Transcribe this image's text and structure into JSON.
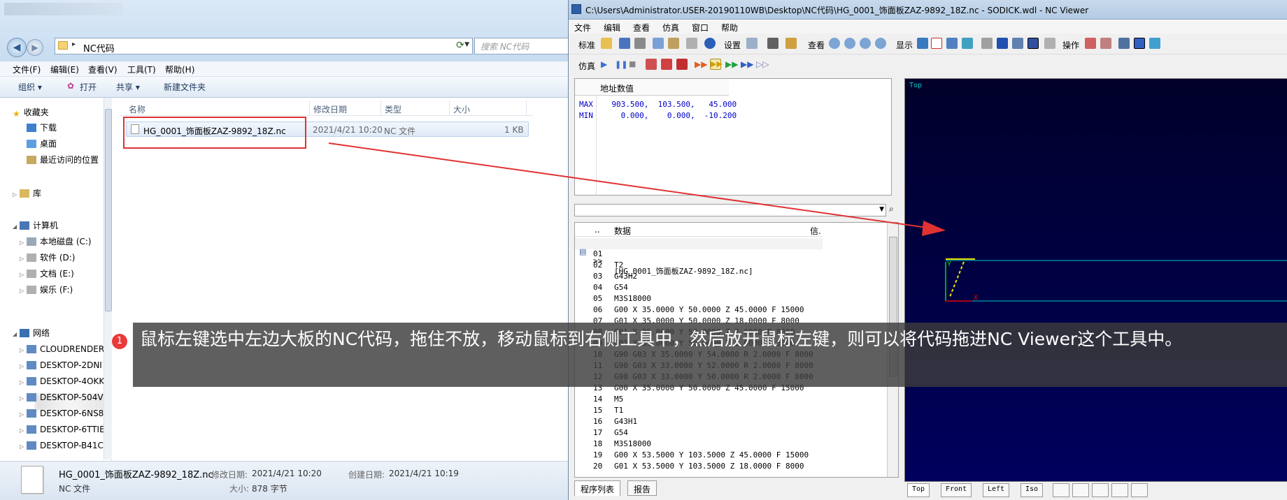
{
  "explorer": {
    "address": "NC代码",
    "search_placeholder": "搜索 NC代码",
    "menu": [
      "文件(F)",
      "编辑(E)",
      "查看(V)",
      "工具(T)",
      "帮助(H)"
    ],
    "commands": {
      "organize": "组织 ▾",
      "open": "打开",
      "share": "共享 ▾",
      "new_folder": "新建文件夹"
    },
    "nav": {
      "favorites": "收藏夹",
      "downloads": "下载",
      "desktop": "桌面",
      "recent": "最近访问的位置",
      "libraries": "库",
      "computer": "计算机",
      "drives": [
        "本地磁盘 (C:)",
        "软件 (D:)",
        "文档 (E:)",
        "娱乐 (F:)"
      ],
      "network": "网络",
      "hosts": [
        "CLOUDRENDER",
        "DESKTOP-2DNI",
        "DESKTOP-4OKK",
        "DESKTOP-504V",
        "DESKTOP-6NS8",
        "DESKTOP-6TTIE",
        "DESKTOP-B41C"
      ]
    },
    "columns": {
      "name": "名称",
      "modified": "修改日期",
      "type": "类型",
      "size": "大小"
    },
    "file": {
      "name": "HG_0001_饰面板ZAZ-9892_18Z.nc",
      "modified": "2021/4/21 10:20",
      "type": "NC 文件",
      "size": "1 KB"
    },
    "details": {
      "name": "HG_0001_饰面板ZAZ-9892_18Z.nc",
      "type": "NC 文件",
      "modified_label": "修改日期:",
      "modified": "2021/4/21 10:20",
      "created_label": "创建日期:",
      "created": "2021/4/21 10:19",
      "size_label": "大小:",
      "size": "878 字节"
    }
  },
  "nc": {
    "title": "C:\\Users\\Administrator.USER-20190110WB\\Desktop\\NC代码\\HG_0001_饰面板ZAZ-9892_18Z.nc - SODICK.wdl - NC Viewer",
    "menu": [
      "文件",
      "编辑",
      "查看",
      "仿真",
      "窗口",
      "帮助"
    ],
    "toolbar_labels": {
      "standard": "标准",
      "settings": "设置",
      "view": "查看",
      "display": "显示",
      "operate": "操作",
      "simulate": "仿真"
    },
    "addr_panel": {
      "header": "地址数值",
      "max_row": "MAX    903.500,  103.500,   45.000",
      "min_row": "MIN      0.000,    0.000,  -10.200"
    },
    "program": {
      "col_dots": "..",
      "col_data": "数据",
      "col_info": "信.",
      "file_marker": ">>",
      "file_line": "[HG_0001_饰面板ZAZ-9892_18Z.nc]",
      "lines": [
        [
          "01",
          ""
        ],
        [
          "02",
          "T2"
        ],
        [
          "03",
          "G43H2"
        ],
        [
          "04",
          "G54"
        ],
        [
          "05",
          "M3S18000"
        ],
        [
          "06",
          "G00 X 35.0000 Y 50.0000 Z 45.0000 F 15000"
        ],
        [
          "07",
          "G01 X 35.0000 Y 50.0000 Z 18.0000 F 8000"
        ],
        [
          "08",
          "G01 X 35.0000 Y 50.0000 Z 2.0000 F 8000"
        ],
        [
          "09",
          "G01 X 35.0000 Y 50.0000 Z 2.0000 F 3000"
        ],
        [
          "10",
          "G90 G03 X 35.0000 Y 54.0000 R 2.0000 F 8000"
        ],
        [
          "11",
          "G90 G03 X 33.0000 Y 52.0000 R 2.0000 F 8000"
        ],
        [
          "12",
          "G90 G03 X 33.0000 Y 50.0000 R 2.0000 F 8000"
        ],
        [
          "13",
          "G00 X 35.0000 Y 50.0000 Z 45.0000 F 15000"
        ],
        [
          "14",
          "M5"
        ],
        [
          "15",
          "T1"
        ],
        [
          "16",
          "G43H1"
        ],
        [
          "17",
          "G54"
        ],
        [
          "18",
          "M3S18000"
        ],
        [
          "19",
          "G00 X 53.5000 Y 103.5000 Z 45.0000 F 15000"
        ],
        [
          "20",
          "G01 X 53.5000 Y 103.5000 Z 18.0000 F 8000"
        ]
      ]
    },
    "panel_tabs": [
      "程序列表",
      "报告"
    ],
    "viewport_label": "Top",
    "view_tabs": [
      "Top",
      "Front",
      "Left",
      "Iso"
    ]
  },
  "annotation": {
    "badge": "1",
    "text": "鼠标左键选中左边大板的NC代码，拖住不放，移动鼠标到右侧工具中，然后放开鼠标左键，则可以将代码拖进NC Viewer这个工具中。"
  },
  "colors": {
    "highlight_box": "#e13232",
    "arrow": "#e13232",
    "viewport_bg": "#000048",
    "path_cyan": "#00c8c8"
  }
}
